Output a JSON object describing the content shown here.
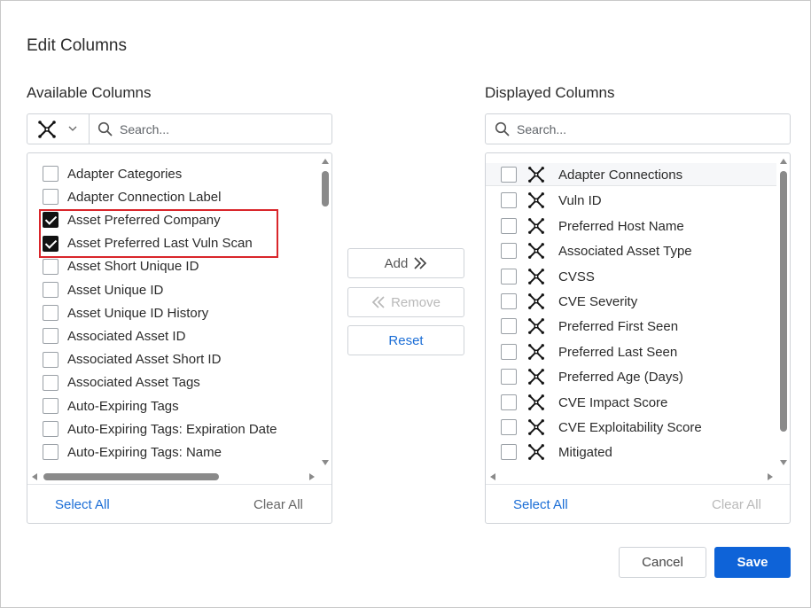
{
  "dialog": {
    "title": "Edit Columns"
  },
  "available": {
    "label": "Available Columns",
    "search_placeholder": "Search...",
    "adapter_filter_icon": "adapter-x-icon",
    "items": [
      {
        "label": "Adapter Categories",
        "checked": false
      },
      {
        "label": "Adapter Connection Label",
        "checked": false
      },
      {
        "label": "Asset Preferred Company",
        "checked": true
      },
      {
        "label": "Asset Preferred Last Vuln Scan",
        "checked": true
      },
      {
        "label": "Asset Short Unique ID",
        "checked": false
      },
      {
        "label": "Asset Unique ID",
        "checked": false
      },
      {
        "label": "Asset Unique ID History",
        "checked": false
      },
      {
        "label": "Associated Asset ID",
        "checked": false
      },
      {
        "label": "Associated Asset Short ID",
        "checked": false
      },
      {
        "label": "Associated Asset Tags",
        "checked": false
      },
      {
        "label": "Auto-Expiring Tags",
        "checked": false
      },
      {
        "label": "Auto-Expiring Tags: Expiration Date",
        "checked": false
      },
      {
        "label": "Auto-Expiring Tags: Name",
        "checked": false
      }
    ],
    "select_all": "Select All",
    "clear_all": "Clear All"
  },
  "actions": {
    "add": "Add",
    "remove": "Remove",
    "reset": "Reset"
  },
  "displayed": {
    "label": "Displayed Columns",
    "search_placeholder": "Search...",
    "items": [
      {
        "label": "Adapter Connections",
        "checked": false
      },
      {
        "label": "Vuln ID",
        "checked": false
      },
      {
        "label": "Preferred Host Name",
        "checked": false
      },
      {
        "label": "Associated Asset Type",
        "checked": false
      },
      {
        "label": "CVSS",
        "checked": false
      },
      {
        "label": "CVE Severity",
        "checked": false
      },
      {
        "label": "Preferred First Seen",
        "checked": false
      },
      {
        "label": "Preferred Last Seen",
        "checked": false
      },
      {
        "label": "Preferred Age (Days)",
        "checked": false
      },
      {
        "label": "CVE Impact Score",
        "checked": false
      },
      {
        "label": "CVE Exploitability Score",
        "checked": false
      },
      {
        "label": "Mitigated",
        "checked": false
      }
    ],
    "select_all": "Select All",
    "clear_all": "Clear All"
  },
  "footer": {
    "cancel": "Cancel",
    "save": "Save"
  },
  "colors": {
    "primary": "#0e63d8",
    "link": "#1a6dd6",
    "highlight": "#d9262b"
  }
}
